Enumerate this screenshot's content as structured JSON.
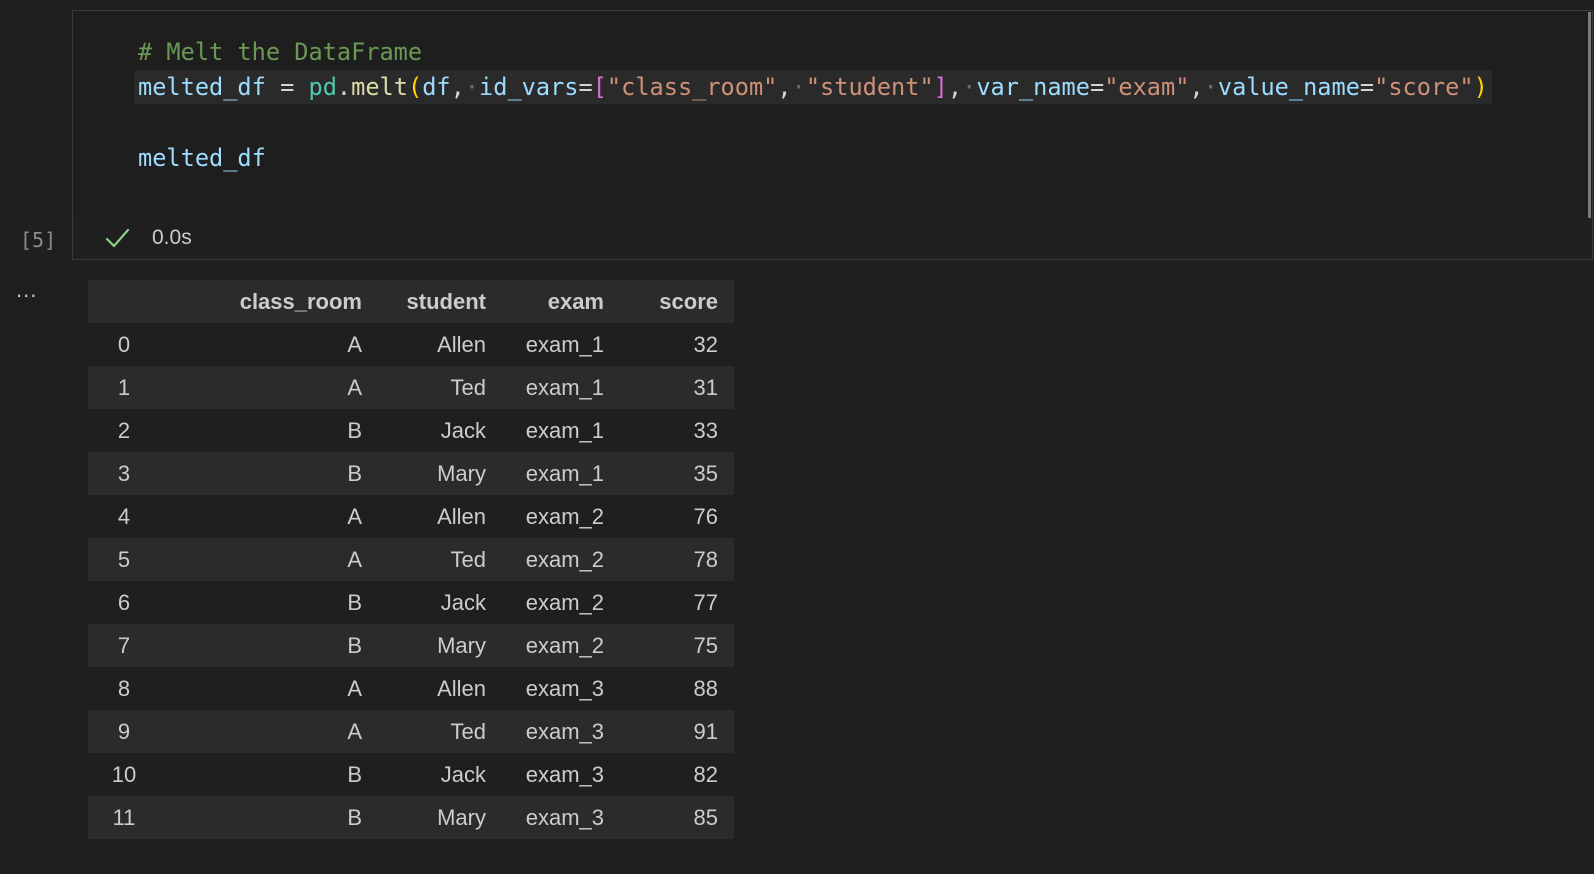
{
  "cell": {
    "execution_count": "[5]",
    "status": "success",
    "duration": "0.0s",
    "output_toggle": "..."
  },
  "code": {
    "comment": "# Melt the DataFrame",
    "line2": [
      {
        "t": "melted_df",
        "c": "var"
      },
      {
        "t": " ",
        "c": "op"
      },
      {
        "t": "=",
        "c": "op"
      },
      {
        "t": " ",
        "c": "op"
      },
      {
        "t": "pd",
        "c": "mod"
      },
      {
        "t": ".",
        "c": "op"
      },
      {
        "t": "melt",
        "c": "fn"
      },
      {
        "t": "(",
        "c": "b1"
      },
      {
        "t": "df",
        "c": "var"
      },
      {
        "t": ",",
        "c": "op"
      },
      {
        "t": "·",
        "c": "ws"
      },
      {
        "t": "id_vars",
        "c": "var"
      },
      {
        "t": "=",
        "c": "op"
      },
      {
        "t": "[",
        "c": "b2"
      },
      {
        "t": "\"class_room\"",
        "c": "str"
      },
      {
        "t": ",",
        "c": "op"
      },
      {
        "t": "·",
        "c": "ws"
      },
      {
        "t": "\"student\"",
        "c": "str"
      },
      {
        "t": "]",
        "c": "b2"
      },
      {
        "t": ",",
        "c": "op"
      },
      {
        "t": "·",
        "c": "ws"
      },
      {
        "t": "var_name",
        "c": "var"
      },
      {
        "t": "=",
        "c": "op"
      },
      {
        "t": "\"exam\"",
        "c": "str"
      },
      {
        "t": ",",
        "c": "op"
      },
      {
        "t": "·",
        "c": "ws"
      },
      {
        "t": "value_name",
        "c": "var"
      },
      {
        "t": "=",
        "c": "op"
      },
      {
        "t": "\"score\"",
        "c": "str"
      },
      {
        "t": ")",
        "c": "b1"
      }
    ],
    "line4": "melted_df"
  },
  "table": {
    "columns": [
      "",
      "class_room",
      "student",
      "exam",
      "score"
    ],
    "rows": [
      [
        "0",
        "A",
        "Allen",
        "exam_1",
        "32"
      ],
      [
        "1",
        "A",
        "Ted",
        "exam_1",
        "31"
      ],
      [
        "2",
        "B",
        "Jack",
        "exam_1",
        "33"
      ],
      [
        "3",
        "B",
        "Mary",
        "exam_1",
        "35"
      ],
      [
        "4",
        "A",
        "Allen",
        "exam_2",
        "76"
      ],
      [
        "5",
        "A",
        "Ted",
        "exam_2",
        "78"
      ],
      [
        "6",
        "B",
        "Jack",
        "exam_2",
        "77"
      ],
      [
        "7",
        "B",
        "Mary",
        "exam_2",
        "75"
      ],
      [
        "8",
        "A",
        "Allen",
        "exam_3",
        "88"
      ],
      [
        "9",
        "A",
        "Ted",
        "exam_3",
        "91"
      ],
      [
        "10",
        "B",
        "Jack",
        "exam_3",
        "82"
      ],
      [
        "11",
        "B",
        "Mary",
        "exam_3",
        "85"
      ]
    ]
  },
  "colors": {
    "background": "#1f1f1f",
    "success_check": "#89d185",
    "comment": "#6a9955",
    "string": "#ce9178",
    "variable": "#9cdcfe",
    "function": "#dcdcaa",
    "module": "#4ec9b0"
  }
}
